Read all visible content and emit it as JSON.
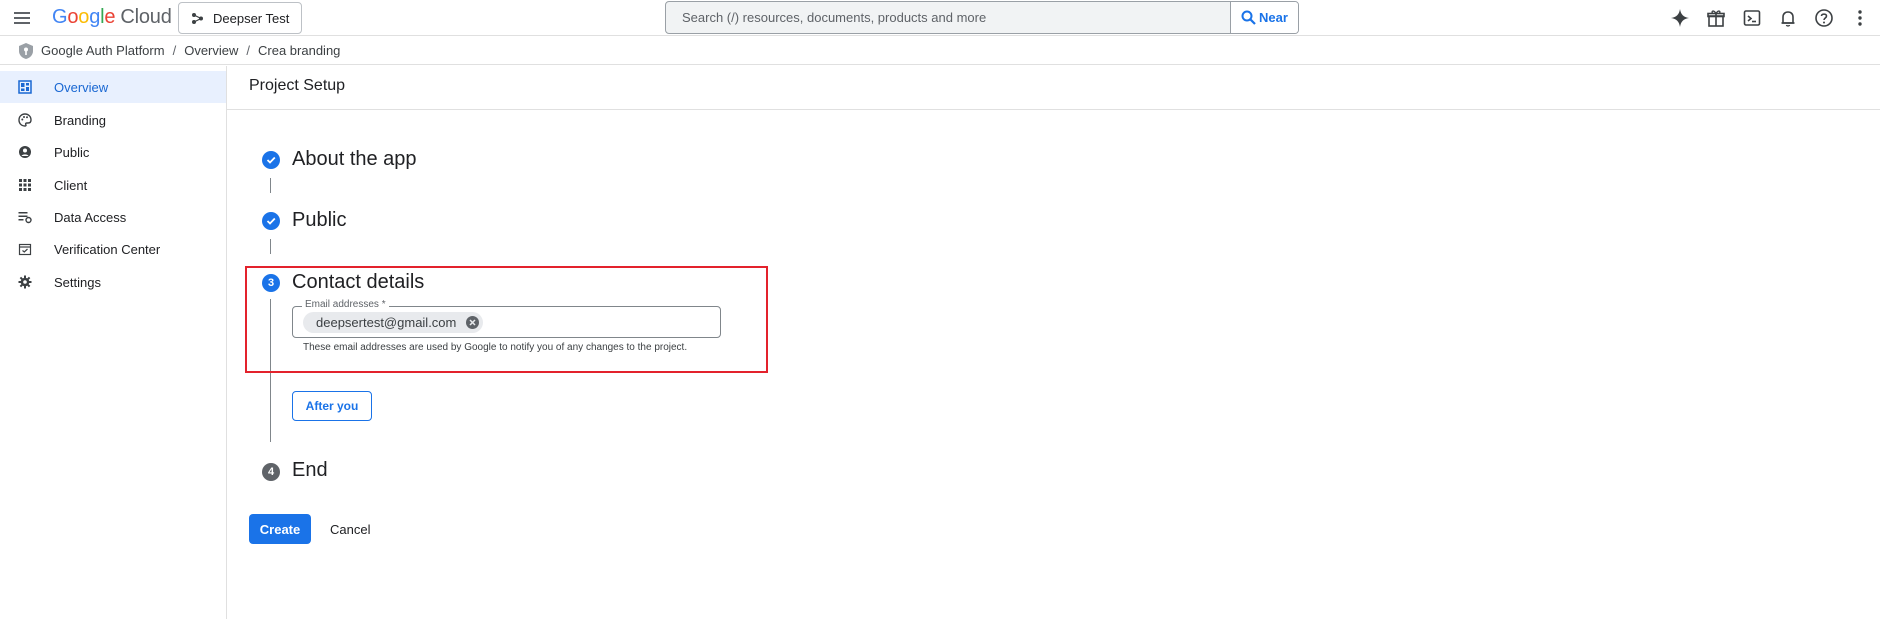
{
  "header": {
    "logo_google": "Google",
    "logo_cloud": "Cloud",
    "project": "Deepser Test",
    "search_placeholder": "Search (/) resources, documents, products and more",
    "search_button": "Near",
    "icons": [
      "menu-icon",
      "gemini-spark-icon",
      "gift-icon",
      "cloud-shell-icon",
      "notifications-bell-icon",
      "help-icon",
      "more-vert-icon"
    ]
  },
  "breadcrumb": {
    "items": [
      "Google Auth Platform",
      "Overview",
      "Crea branding"
    ],
    "separator": "/"
  },
  "sidebar": {
    "items": [
      {
        "label": "Overview",
        "icon": "dashboard-icon",
        "active": true
      },
      {
        "label": "Branding",
        "icon": "palette-icon",
        "active": false
      },
      {
        "label": "Public",
        "icon": "account-circle-icon",
        "active": false
      },
      {
        "label": "Client",
        "icon": "apps-grid-icon",
        "active": false
      },
      {
        "label": "Data Access",
        "icon": "data-access-icon",
        "active": false
      },
      {
        "label": "Verification Center",
        "icon": "calendar-check-icon",
        "active": false
      },
      {
        "label": "Settings",
        "icon": "gear-icon",
        "active": false
      }
    ]
  },
  "main": {
    "title": "Project Setup",
    "steps": [
      {
        "number": "1",
        "title": "About the app",
        "status": "completed"
      },
      {
        "number": "2",
        "title": "Public",
        "status": "completed"
      },
      {
        "number": "3",
        "title": "Contact details",
        "status": "current"
      },
      {
        "number": "4",
        "title": "End",
        "status": "pending"
      }
    ],
    "contact": {
      "email_label": "Email addresses *",
      "email_chip": "deepsertest@gmail.com",
      "hint": "These email addresses are used by Google to notify you of any changes to the project.",
      "next_button": "After you"
    },
    "actions": {
      "create": "Create",
      "cancel": "Cancel"
    }
  },
  "colors": {
    "accent": "#1a73e8",
    "active_bg": "#e8f0fe",
    "highlight_border": "#e3222c",
    "pending_step": "#5f6368"
  }
}
